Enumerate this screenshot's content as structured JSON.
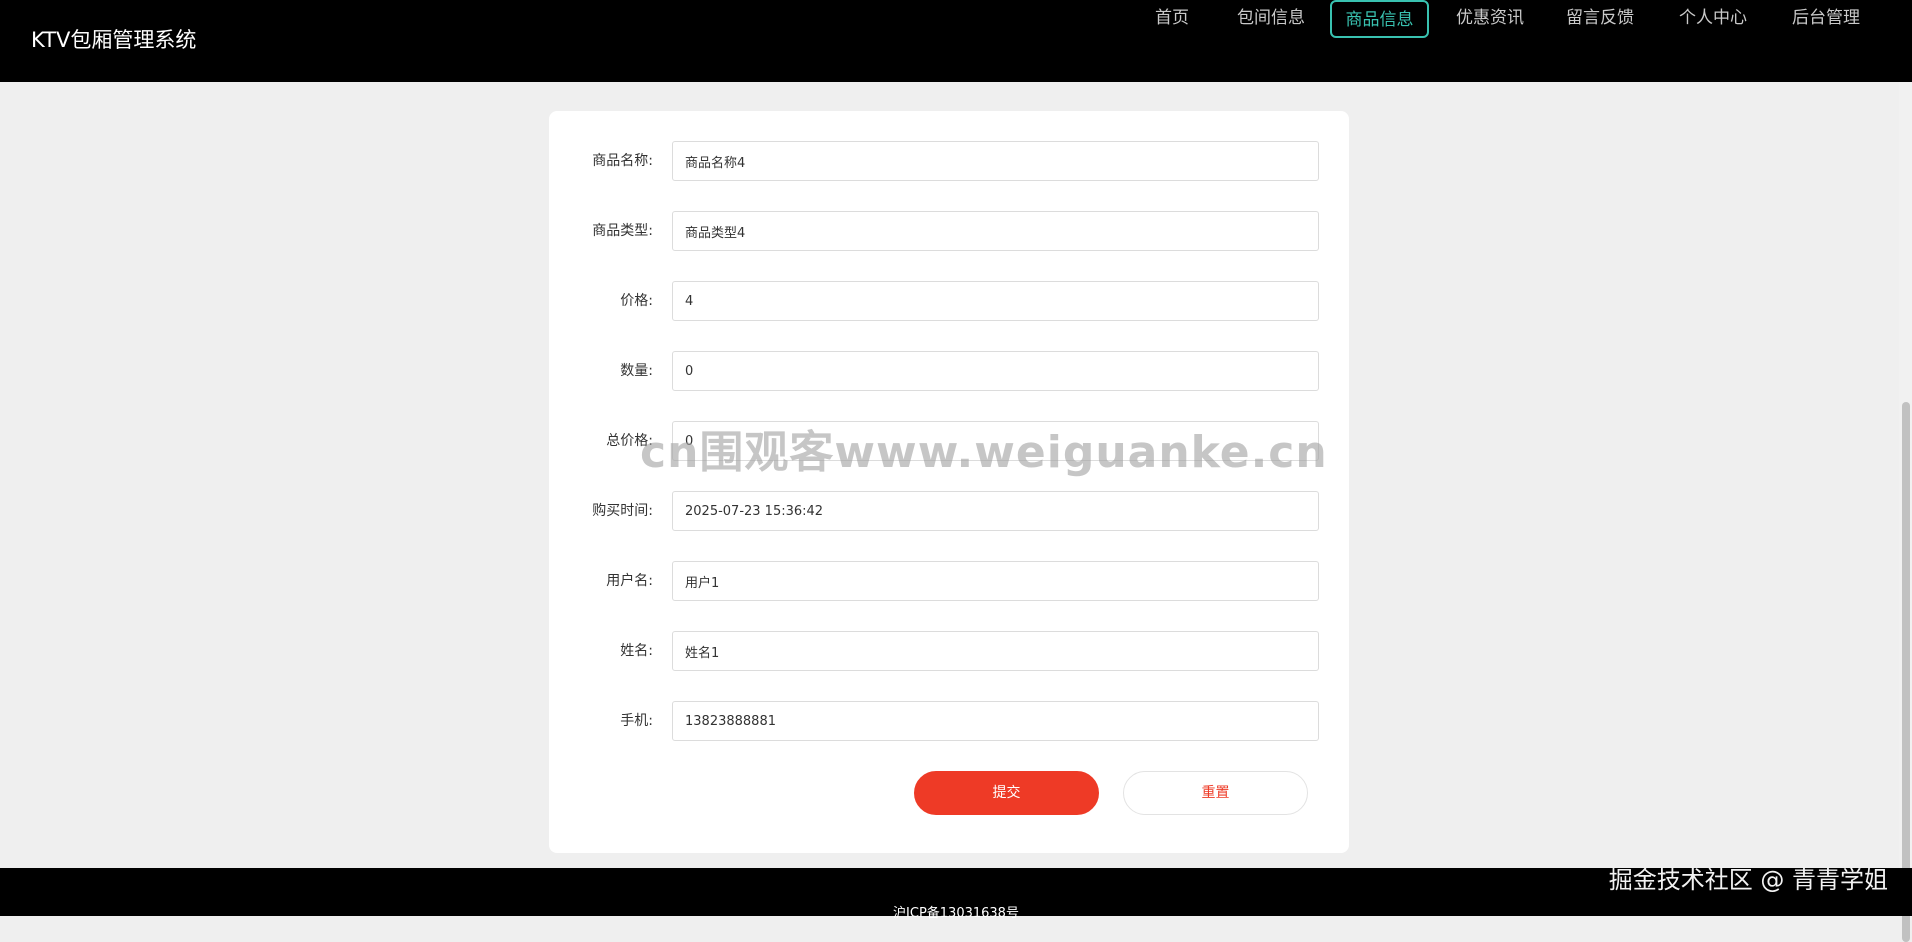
{
  "header": {
    "brand": "KTV包厢管理系统",
    "nav": [
      {
        "label": "首页",
        "active": false
      },
      {
        "label": "包间信息",
        "active": false
      },
      {
        "label": "商品信息",
        "active": true
      },
      {
        "label": "优惠资讯",
        "active": false
      },
      {
        "label": "留言反馈",
        "active": false
      },
      {
        "label": "个人中心",
        "active": false
      },
      {
        "label": "后台管理",
        "active": false
      }
    ]
  },
  "form": {
    "fields": [
      {
        "label": "商品名称:",
        "value": "商品名称4"
      },
      {
        "label": "商品类型:",
        "value": "商品类型4"
      },
      {
        "label": "价格:",
        "value": "4"
      },
      {
        "label": "数量:",
        "value": "0"
      },
      {
        "label": "总价格:",
        "value": "0"
      },
      {
        "label": "购买时间:",
        "value": "2025-07-23 15:36:42"
      },
      {
        "label": "用户名:",
        "value": "用户1"
      },
      {
        "label": "姓名:",
        "value": "姓名1"
      },
      {
        "label": "手机:",
        "value": "13823888881"
      }
    ],
    "submit_label": "提交",
    "reset_label": "重置"
  },
  "footer": {
    "icp": "沪ICP备13031638号",
    "community": "掘金技术社区 @ 青青学姐"
  },
  "watermark": "cn围观客www.weiguanke.cn",
  "colors": {
    "accent": "#39c2b0",
    "primary_button": "#ee3a26"
  }
}
